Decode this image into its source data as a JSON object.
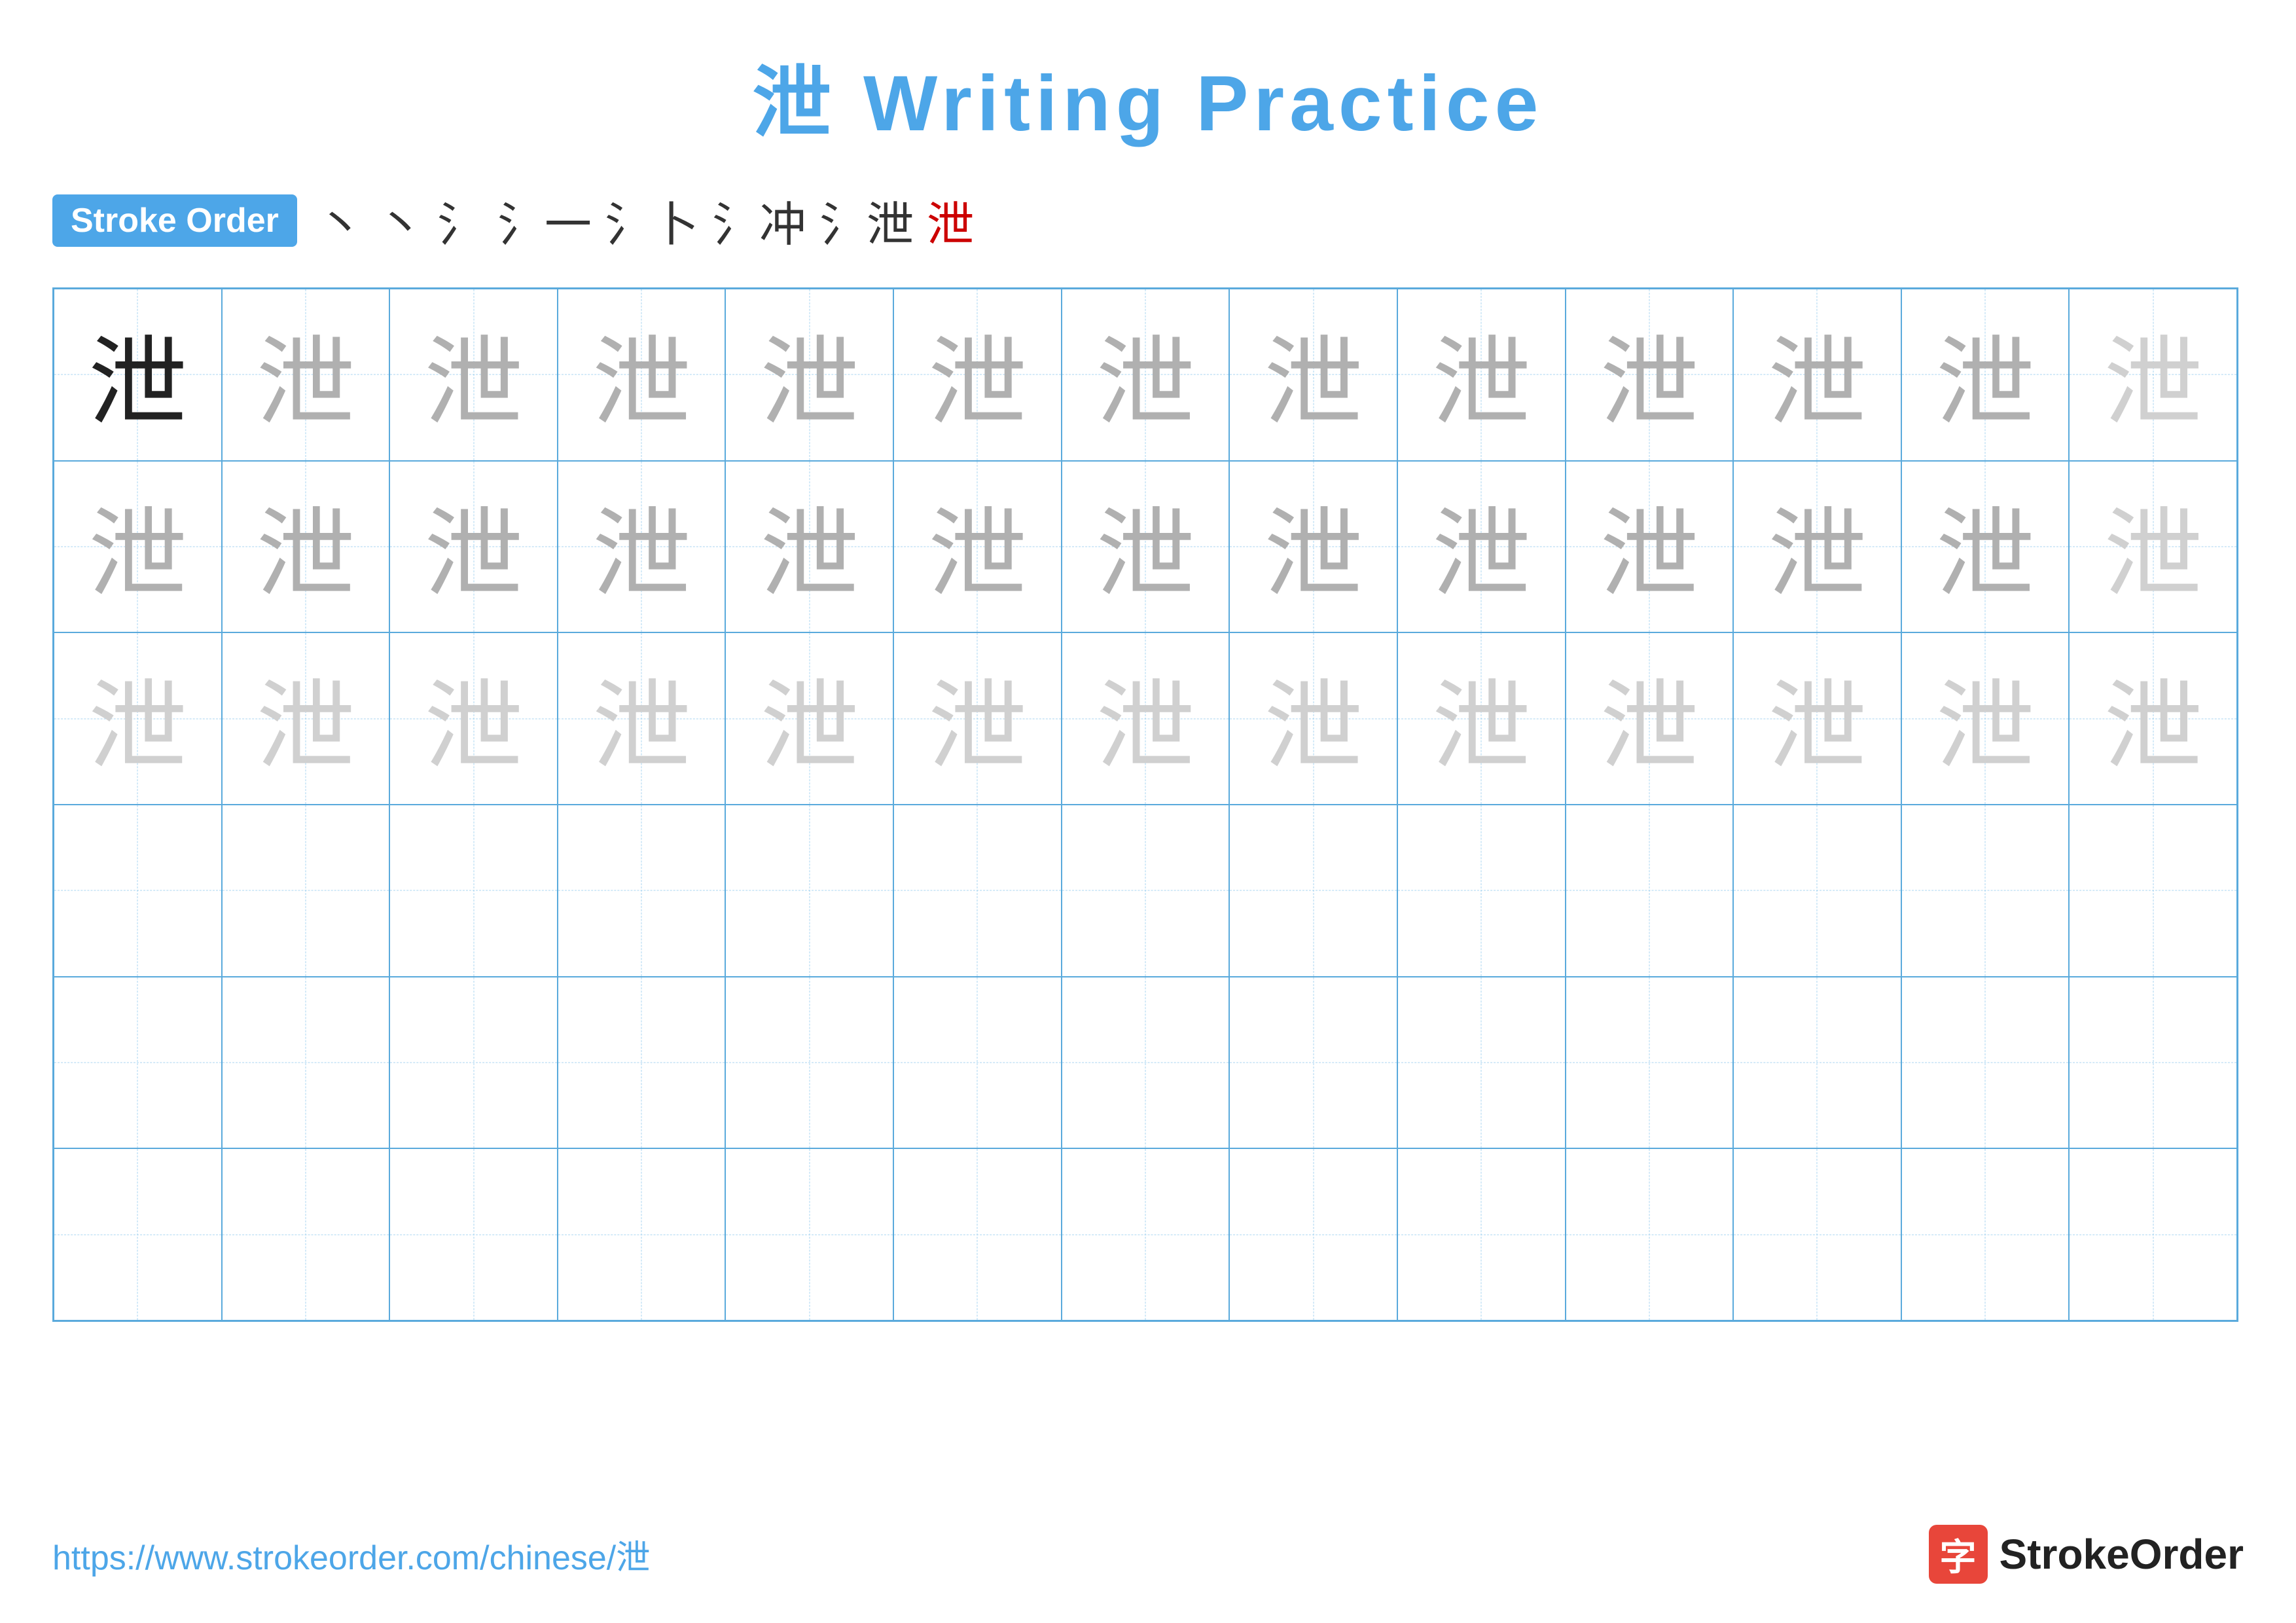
{
  "title": "泄 Writing Practice",
  "stroke_order_badge": "Stroke Order",
  "stroke_steps": [
    "丶",
    "丶",
    "氵",
    "氵-",
    "氵卜",
    "氵冲",
    "氵泄",
    "泄"
  ],
  "stroke_steps_red_index": 7,
  "character": "泄",
  "grid": {
    "cols": 13,
    "rows": 6,
    "cells": [
      {
        "row": 0,
        "style": "dark"
      },
      {
        "row": 0,
        "style": "medium"
      },
      {
        "row": 0,
        "style": "medium"
      },
      {
        "row": 0,
        "style": "medium"
      },
      {
        "row": 0,
        "style": "medium"
      },
      {
        "row": 0,
        "style": "medium"
      },
      {
        "row": 0,
        "style": "medium"
      },
      {
        "row": 0,
        "style": "medium"
      },
      {
        "row": 0,
        "style": "medium"
      },
      {
        "row": 0,
        "style": "medium"
      },
      {
        "row": 0,
        "style": "medium"
      },
      {
        "row": 0,
        "style": "medium"
      },
      {
        "row": 0,
        "style": "light"
      },
      {
        "row": 1,
        "style": "medium"
      },
      {
        "row": 1,
        "style": "medium"
      },
      {
        "row": 1,
        "style": "medium"
      },
      {
        "row": 1,
        "style": "medium"
      },
      {
        "row": 1,
        "style": "medium"
      },
      {
        "row": 1,
        "style": "medium"
      },
      {
        "row": 1,
        "style": "medium"
      },
      {
        "row": 1,
        "style": "medium"
      },
      {
        "row": 1,
        "style": "medium"
      },
      {
        "row": 1,
        "style": "medium"
      },
      {
        "row": 1,
        "style": "medium"
      },
      {
        "row": 1,
        "style": "medium"
      },
      {
        "row": 1,
        "style": "light"
      },
      {
        "row": 2,
        "style": "light"
      },
      {
        "row": 2,
        "style": "light"
      },
      {
        "row": 2,
        "style": "light"
      },
      {
        "row": 2,
        "style": "light"
      },
      {
        "row": 2,
        "style": "light"
      },
      {
        "row": 2,
        "style": "light"
      },
      {
        "row": 2,
        "style": "light"
      },
      {
        "row": 2,
        "style": "light"
      },
      {
        "row": 2,
        "style": "light"
      },
      {
        "row": 2,
        "style": "light"
      },
      {
        "row": 2,
        "style": "light"
      },
      {
        "row": 2,
        "style": "light"
      },
      {
        "row": 2,
        "style": "light"
      },
      {
        "row": 3,
        "style": "empty"
      },
      {
        "row": 3,
        "style": "empty"
      },
      {
        "row": 3,
        "style": "empty"
      },
      {
        "row": 3,
        "style": "empty"
      },
      {
        "row": 3,
        "style": "empty"
      },
      {
        "row": 3,
        "style": "empty"
      },
      {
        "row": 3,
        "style": "empty"
      },
      {
        "row": 3,
        "style": "empty"
      },
      {
        "row": 3,
        "style": "empty"
      },
      {
        "row": 3,
        "style": "empty"
      },
      {
        "row": 3,
        "style": "empty"
      },
      {
        "row": 3,
        "style": "empty"
      },
      {
        "row": 3,
        "style": "empty"
      },
      {
        "row": 4,
        "style": "empty"
      },
      {
        "row": 4,
        "style": "empty"
      },
      {
        "row": 4,
        "style": "empty"
      },
      {
        "row": 4,
        "style": "empty"
      },
      {
        "row": 4,
        "style": "empty"
      },
      {
        "row": 4,
        "style": "empty"
      },
      {
        "row": 4,
        "style": "empty"
      },
      {
        "row": 4,
        "style": "empty"
      },
      {
        "row": 4,
        "style": "empty"
      },
      {
        "row": 4,
        "style": "empty"
      },
      {
        "row": 4,
        "style": "empty"
      },
      {
        "row": 4,
        "style": "empty"
      },
      {
        "row": 4,
        "style": "empty"
      },
      {
        "row": 5,
        "style": "empty"
      },
      {
        "row": 5,
        "style": "empty"
      },
      {
        "row": 5,
        "style": "empty"
      },
      {
        "row": 5,
        "style": "empty"
      },
      {
        "row": 5,
        "style": "empty"
      },
      {
        "row": 5,
        "style": "empty"
      },
      {
        "row": 5,
        "style": "empty"
      },
      {
        "row": 5,
        "style": "empty"
      },
      {
        "row": 5,
        "style": "empty"
      },
      {
        "row": 5,
        "style": "empty"
      },
      {
        "row": 5,
        "style": "empty"
      },
      {
        "row": 5,
        "style": "empty"
      },
      {
        "row": 5,
        "style": "empty"
      }
    ]
  },
  "footer": {
    "url": "https://www.strokeorder.com/chinese/泄",
    "logo_char": "字",
    "logo_text": "StrokeOrder"
  }
}
